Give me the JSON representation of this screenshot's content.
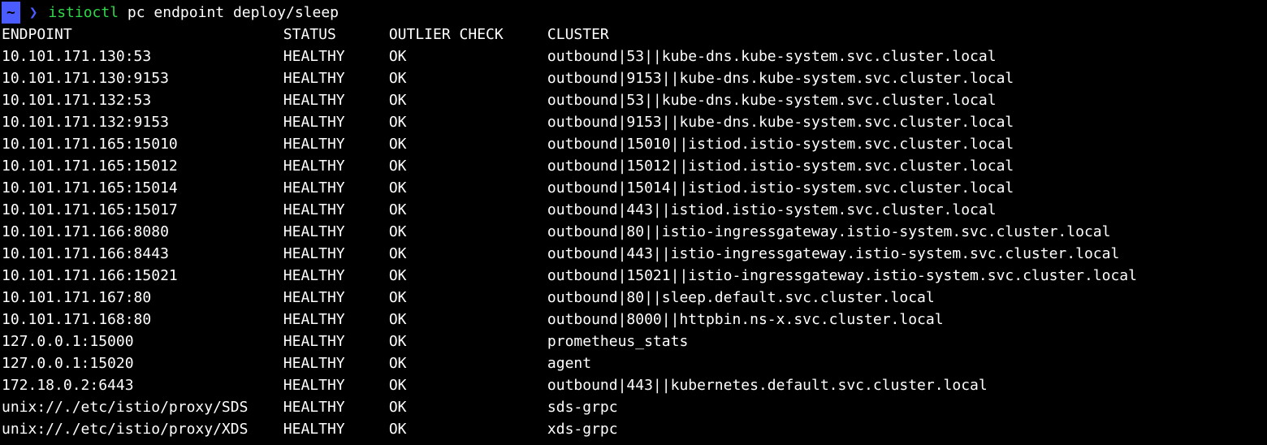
{
  "prompt": {
    "dir": "~",
    "arrow": "❯",
    "command_bin": "istioctl",
    "command_args": " pc endpoint deploy/sleep"
  },
  "columns": {
    "endpoint_w": 32,
    "status_w": 12,
    "outlier_w": 18
  },
  "headers": {
    "endpoint": "ENDPOINT",
    "status": "STATUS",
    "outlier": "OUTLIER CHECK",
    "cluster": "CLUSTER"
  },
  "rows": [
    {
      "endpoint": "10.101.171.130:53",
      "status": "HEALTHY",
      "outlier": "OK",
      "cluster": "outbound|53||kube-dns.kube-system.svc.cluster.local"
    },
    {
      "endpoint": "10.101.171.130:9153",
      "status": "HEALTHY",
      "outlier": "OK",
      "cluster": "outbound|9153||kube-dns.kube-system.svc.cluster.local"
    },
    {
      "endpoint": "10.101.171.132:53",
      "status": "HEALTHY",
      "outlier": "OK",
      "cluster": "outbound|53||kube-dns.kube-system.svc.cluster.local"
    },
    {
      "endpoint": "10.101.171.132:9153",
      "status": "HEALTHY",
      "outlier": "OK",
      "cluster": "outbound|9153||kube-dns.kube-system.svc.cluster.local"
    },
    {
      "endpoint": "10.101.171.165:15010",
      "status": "HEALTHY",
      "outlier": "OK",
      "cluster": "outbound|15010||istiod.istio-system.svc.cluster.local"
    },
    {
      "endpoint": "10.101.171.165:15012",
      "status": "HEALTHY",
      "outlier": "OK",
      "cluster": "outbound|15012||istiod.istio-system.svc.cluster.local"
    },
    {
      "endpoint": "10.101.171.165:15014",
      "status": "HEALTHY",
      "outlier": "OK",
      "cluster": "outbound|15014||istiod.istio-system.svc.cluster.local"
    },
    {
      "endpoint": "10.101.171.165:15017",
      "status": "HEALTHY",
      "outlier": "OK",
      "cluster": "outbound|443||istiod.istio-system.svc.cluster.local"
    },
    {
      "endpoint": "10.101.171.166:8080",
      "status": "HEALTHY",
      "outlier": "OK",
      "cluster": "outbound|80||istio-ingressgateway.istio-system.svc.cluster.local"
    },
    {
      "endpoint": "10.101.171.166:8443",
      "status": "HEALTHY",
      "outlier": "OK",
      "cluster": "outbound|443||istio-ingressgateway.istio-system.svc.cluster.local"
    },
    {
      "endpoint": "10.101.171.166:15021",
      "status": "HEALTHY",
      "outlier": "OK",
      "cluster": "outbound|15021||istio-ingressgateway.istio-system.svc.cluster.local"
    },
    {
      "endpoint": "10.101.171.167:80",
      "status": "HEALTHY",
      "outlier": "OK",
      "cluster": "outbound|80||sleep.default.svc.cluster.local"
    },
    {
      "endpoint": "10.101.171.168:80",
      "status": "HEALTHY",
      "outlier": "OK",
      "cluster": "outbound|8000||httpbin.ns-x.svc.cluster.local"
    },
    {
      "endpoint": "127.0.0.1:15000",
      "status": "HEALTHY",
      "outlier": "OK",
      "cluster": "prometheus_stats"
    },
    {
      "endpoint": "127.0.0.1:15020",
      "status": "HEALTHY",
      "outlier": "OK",
      "cluster": "agent"
    },
    {
      "endpoint": "172.18.0.2:6443",
      "status": "HEALTHY",
      "outlier": "OK",
      "cluster": "outbound|443||kubernetes.default.svc.cluster.local"
    },
    {
      "endpoint": "unix://./etc/istio/proxy/SDS",
      "status": "HEALTHY",
      "outlier": "OK",
      "cluster": "sds-grpc"
    },
    {
      "endpoint": "unix://./etc/istio/proxy/XDS",
      "status": "HEALTHY",
      "outlier": "OK",
      "cluster": "xds-grpc"
    }
  ]
}
